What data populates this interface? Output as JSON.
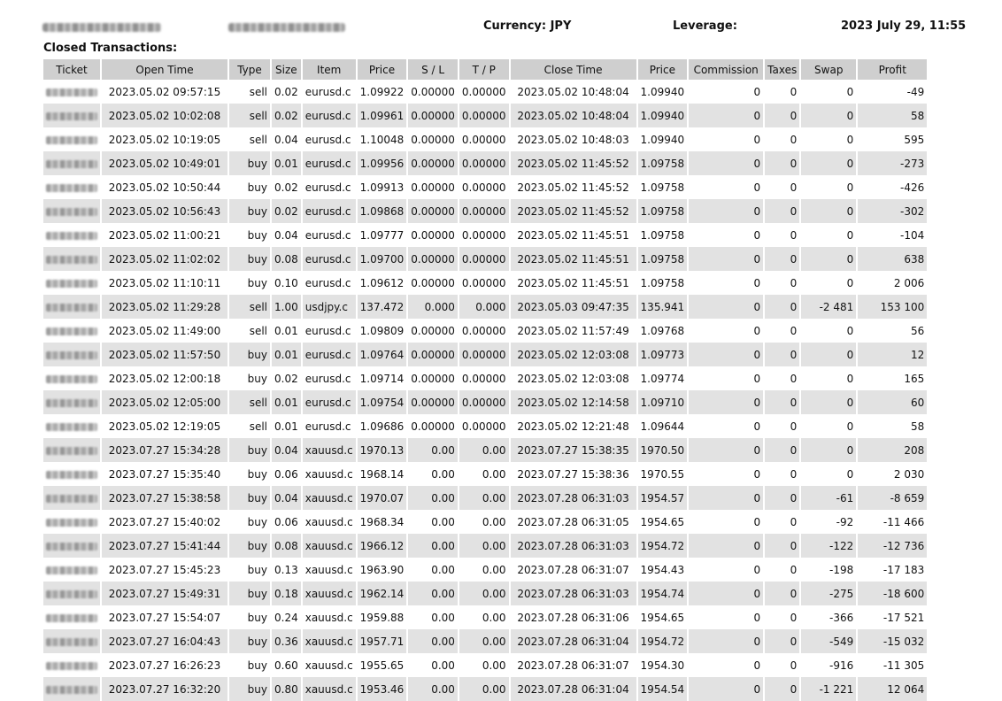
{
  "header": {
    "currency": "Currency: JPY",
    "leverage": "Leverage:",
    "datetime": "2023 July 29, 11:55"
  },
  "section_title": "Closed Transactions:",
  "columns": [
    "Ticket",
    "Open Time",
    "Type",
    "Size",
    "Item",
    "Price",
    "S / L",
    "T / P",
    "Close Time",
    "Price",
    "Commission",
    "Taxes",
    "Swap",
    "Profit"
  ],
  "rows": [
    [
      "2023.05.02 09:57:15",
      "sell",
      "0.02",
      "eurusd.c",
      "1.09922",
      "0.00000",
      "0.00000",
      "2023.05.02 10:48:04",
      "1.09940",
      "0",
      "0",
      "0",
      "-49"
    ],
    [
      "2023.05.02 10:02:08",
      "sell",
      "0.02",
      "eurusd.c",
      "1.09961",
      "0.00000",
      "0.00000",
      "2023.05.02 10:48:04",
      "1.09940",
      "0",
      "0",
      "0",
      "58"
    ],
    [
      "2023.05.02 10:19:05",
      "sell",
      "0.04",
      "eurusd.c",
      "1.10048",
      "0.00000",
      "0.00000",
      "2023.05.02 10:48:03",
      "1.09940",
      "0",
      "0",
      "0",
      "595"
    ],
    [
      "2023.05.02 10:49:01",
      "buy",
      "0.01",
      "eurusd.c",
      "1.09956",
      "0.00000",
      "0.00000",
      "2023.05.02 11:45:52",
      "1.09758",
      "0",
      "0",
      "0",
      "-273"
    ],
    [
      "2023.05.02 10:50:44",
      "buy",
      "0.02",
      "eurusd.c",
      "1.09913",
      "0.00000",
      "0.00000",
      "2023.05.02 11:45:52",
      "1.09758",
      "0",
      "0",
      "0",
      "-426"
    ],
    [
      "2023.05.02 10:56:43",
      "buy",
      "0.02",
      "eurusd.c",
      "1.09868",
      "0.00000",
      "0.00000",
      "2023.05.02 11:45:52",
      "1.09758",
      "0",
      "0",
      "0",
      "-302"
    ],
    [
      "2023.05.02 11:00:21",
      "buy",
      "0.04",
      "eurusd.c",
      "1.09777",
      "0.00000",
      "0.00000",
      "2023.05.02 11:45:51",
      "1.09758",
      "0",
      "0",
      "0",
      "-104"
    ],
    [
      "2023.05.02 11:02:02",
      "buy",
      "0.08",
      "eurusd.c",
      "1.09700",
      "0.00000",
      "0.00000",
      "2023.05.02 11:45:51",
      "1.09758",
      "0",
      "0",
      "0",
      "638"
    ],
    [
      "2023.05.02 11:10:11",
      "buy",
      "0.10",
      "eurusd.c",
      "1.09612",
      "0.00000",
      "0.00000",
      "2023.05.02 11:45:51",
      "1.09758",
      "0",
      "0",
      "0",
      "2 006"
    ],
    [
      "2023.05.02 11:29:28",
      "sell",
      "1.00",
      "usdjpy.c",
      "137.472",
      "0.000",
      "0.000",
      "2023.05.03 09:47:35",
      "135.941",
      "0",
      "0",
      "-2 481",
      "153 100"
    ],
    [
      "2023.05.02 11:49:00",
      "sell",
      "0.01",
      "eurusd.c",
      "1.09809",
      "0.00000",
      "0.00000",
      "2023.05.02 11:57:49",
      "1.09768",
      "0",
      "0",
      "0",
      "56"
    ],
    [
      "2023.05.02 11:57:50",
      "buy",
      "0.01",
      "eurusd.c",
      "1.09764",
      "0.00000",
      "0.00000",
      "2023.05.02 12:03:08",
      "1.09773",
      "0",
      "0",
      "0",
      "12"
    ],
    [
      "2023.05.02 12:00:18",
      "buy",
      "0.02",
      "eurusd.c",
      "1.09714",
      "0.00000",
      "0.00000",
      "2023.05.02 12:03:08",
      "1.09774",
      "0",
      "0",
      "0",
      "165"
    ],
    [
      "2023.05.02 12:05:00",
      "sell",
      "0.01",
      "eurusd.c",
      "1.09754",
      "0.00000",
      "0.00000",
      "2023.05.02 12:14:58",
      "1.09710",
      "0",
      "0",
      "0",
      "60"
    ],
    [
      "2023.05.02 12:19:05",
      "sell",
      "0.01",
      "eurusd.c",
      "1.09686",
      "0.00000",
      "0.00000",
      "2023.05.02 12:21:48",
      "1.09644",
      "0",
      "0",
      "0",
      "58"
    ],
    [
      "2023.07.27 15:34:28",
      "buy",
      "0.04",
      "xauusd.c",
      "1970.13",
      "0.00",
      "0.00",
      "2023.07.27 15:38:35",
      "1970.50",
      "0",
      "0",
      "0",
      "208"
    ],
    [
      "2023.07.27 15:35:40",
      "buy",
      "0.06",
      "xauusd.c",
      "1968.14",
      "0.00",
      "0.00",
      "2023.07.27 15:38:36",
      "1970.55",
      "0",
      "0",
      "0",
      "2 030"
    ],
    [
      "2023.07.27 15:38:58",
      "buy",
      "0.04",
      "xauusd.c",
      "1970.07",
      "0.00",
      "0.00",
      "2023.07.28 06:31:03",
      "1954.57",
      "0",
      "0",
      "-61",
      "-8 659"
    ],
    [
      "2023.07.27 15:40:02",
      "buy",
      "0.06",
      "xauusd.c",
      "1968.34",
      "0.00",
      "0.00",
      "2023.07.28 06:31:05",
      "1954.65",
      "0",
      "0",
      "-92",
      "-11 466"
    ],
    [
      "2023.07.27 15:41:44",
      "buy",
      "0.08",
      "xauusd.c",
      "1966.12",
      "0.00",
      "0.00",
      "2023.07.28 06:31:03",
      "1954.72",
      "0",
      "0",
      "-122",
      "-12 736"
    ],
    [
      "2023.07.27 15:45:23",
      "buy",
      "0.13",
      "xauusd.c",
      "1963.90",
      "0.00",
      "0.00",
      "2023.07.28 06:31:07",
      "1954.43",
      "0",
      "0",
      "-198",
      "-17 183"
    ],
    [
      "2023.07.27 15:49:31",
      "buy",
      "0.18",
      "xauusd.c",
      "1962.14",
      "0.00",
      "0.00",
      "2023.07.28 06:31:03",
      "1954.74",
      "0",
      "0",
      "-275",
      "-18 600"
    ],
    [
      "2023.07.27 15:54:07",
      "buy",
      "0.24",
      "xauusd.c",
      "1959.88",
      "0.00",
      "0.00",
      "2023.07.28 06:31:06",
      "1954.65",
      "0",
      "0",
      "-366",
      "-17 521"
    ],
    [
      "2023.07.27 16:04:43",
      "buy",
      "0.36",
      "xauusd.c",
      "1957.71",
      "0.00",
      "0.00",
      "2023.07.28 06:31:04",
      "1954.72",
      "0",
      "0",
      "-549",
      "-15 032"
    ],
    [
      "2023.07.27 16:26:23",
      "buy",
      "0.60",
      "xauusd.c",
      "1955.65",
      "0.00",
      "0.00",
      "2023.07.28 06:31:07",
      "1954.30",
      "0",
      "0",
      "-916",
      "-11 305"
    ],
    [
      "2023.07.27 16:32:20",
      "buy",
      "0.80",
      "xauusd.c",
      "1953.46",
      "0.00",
      "0.00",
      "2023.07.28 06:31:04",
      "1954.54",
      "0",
      "0",
      "-1 221",
      "12 064"
    ]
  ]
}
